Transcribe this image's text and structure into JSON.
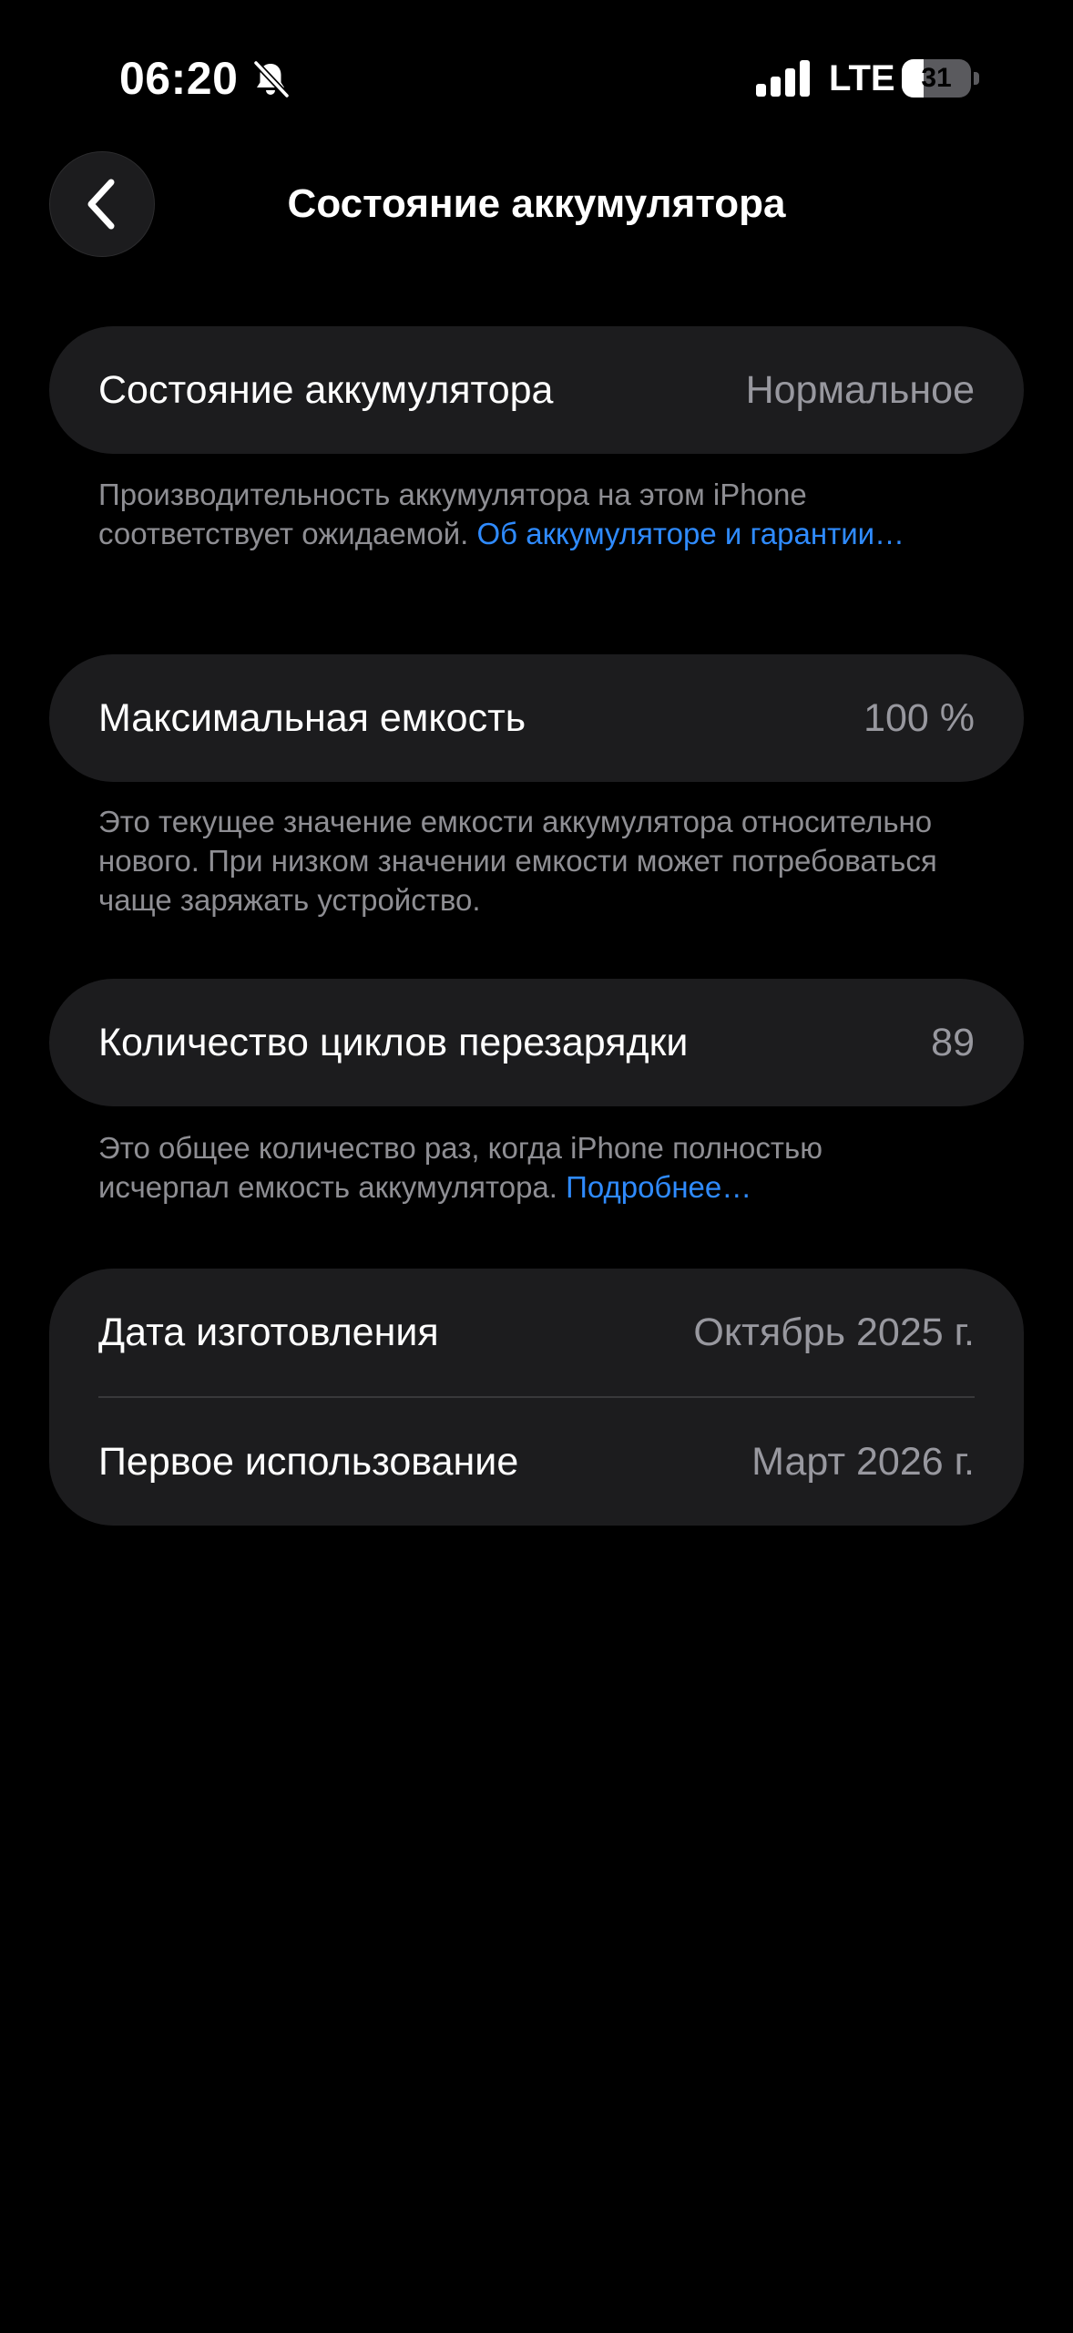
{
  "status_bar": {
    "time": "06:20",
    "silent_icon": "bell-slash-icon",
    "signal_icon": "cellular-signal-icon",
    "network": "LTE",
    "battery_level": "31",
    "battery_fraction": 0.31
  },
  "nav": {
    "back_icon": "chevron-left-icon",
    "title": "Состояние аккумулятора"
  },
  "health": {
    "label": "Состояние аккумулятора",
    "value": "Нормальное",
    "note": "Производительность аккумулятора на этом iPhone соответствует ожидаемой.",
    "link": "Об аккумуляторе и гарантии…"
  },
  "capacity": {
    "label": "Максимальная емкость",
    "value": "100 %",
    "note": "Это текущее значение емкости аккумулятора относительно нового. При низком значении емкости может потребоваться чаще заряжать устройство."
  },
  "cycles": {
    "label": "Количество циклов перезарядки",
    "value": "89",
    "note": "Это общее количество раз, когда iPhone полностью исчерпал емкость аккумулятора.",
    "link": "Подробнее…"
  },
  "dates": {
    "manufacture_label": "Дата изготовления",
    "manufacture_value": "Октябрь 2025 г.",
    "first_use_label": "Первое использование",
    "first_use_value": "Март 2026 г."
  },
  "colors": {
    "background": "#000000",
    "card": "#1c1c1e",
    "secondary_text": "#98989f",
    "footnote_text": "#8e8e93",
    "link": "#2f8bff",
    "divider": "#38383a"
  }
}
